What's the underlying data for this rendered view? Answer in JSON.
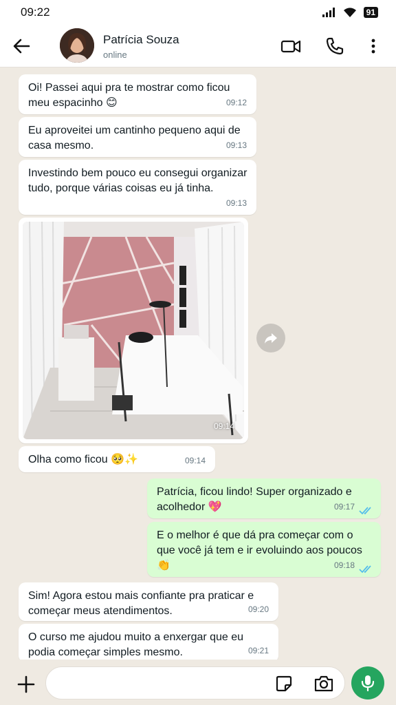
{
  "status_bar": {
    "time": "09:22",
    "battery": "91"
  },
  "header": {
    "contact_name": "Patrícia Souza",
    "contact_status": "online"
  },
  "messages": [
    {
      "direction": "in",
      "text": "Oi! Passei aqui pra te mostrar como ficou meu espacinho 😊",
      "time": "09:12"
    },
    {
      "direction": "in",
      "text": "Eu aproveitei um cantinho pequeno aqui de casa mesmo.",
      "time": "09:13"
    },
    {
      "direction": "in",
      "text": "Investindo bem pouco eu consegui organizar tudo, porque várias coisas eu já tinha.",
      "time": "09:13"
    },
    {
      "direction": "in",
      "type": "image",
      "time": "09:14"
    },
    {
      "direction": "in",
      "text": "Olha como ficou 🥺✨",
      "time": "09:14"
    },
    {
      "direction": "out",
      "text": "Patrícia, ficou lindo! Super organizado e acolhedor 💖",
      "time": "09:17",
      "status": "read"
    },
    {
      "direction": "out",
      "text": "E o melhor é que dá pra começar com o que você já tem e ir evoluindo aos poucos 👏",
      "time": "09:18",
      "status": "read"
    },
    {
      "direction": "in",
      "text": "Sim! Agora estou mais confiante pra praticar e começar meus atendimentos.",
      "time": "09:20"
    },
    {
      "direction": "in",
      "text": "O curso me ajudou muito a enxergar que eu podia começar simples mesmo.",
      "time": "09:21"
    }
  ],
  "input": {
    "value": ""
  },
  "colors": {
    "accent": "#25a55f",
    "outgoing_bubble": "#d9fdd3",
    "incoming_bubble": "#ffffff",
    "chat_bg": "#efeae2",
    "read_tick": "#53bdeb"
  },
  "icons": [
    "back-arrow-icon",
    "video-call-icon",
    "phone-icon",
    "more-vert-icon",
    "forward-icon",
    "plus-icon",
    "sticker-icon",
    "camera-icon",
    "mic-icon"
  ]
}
